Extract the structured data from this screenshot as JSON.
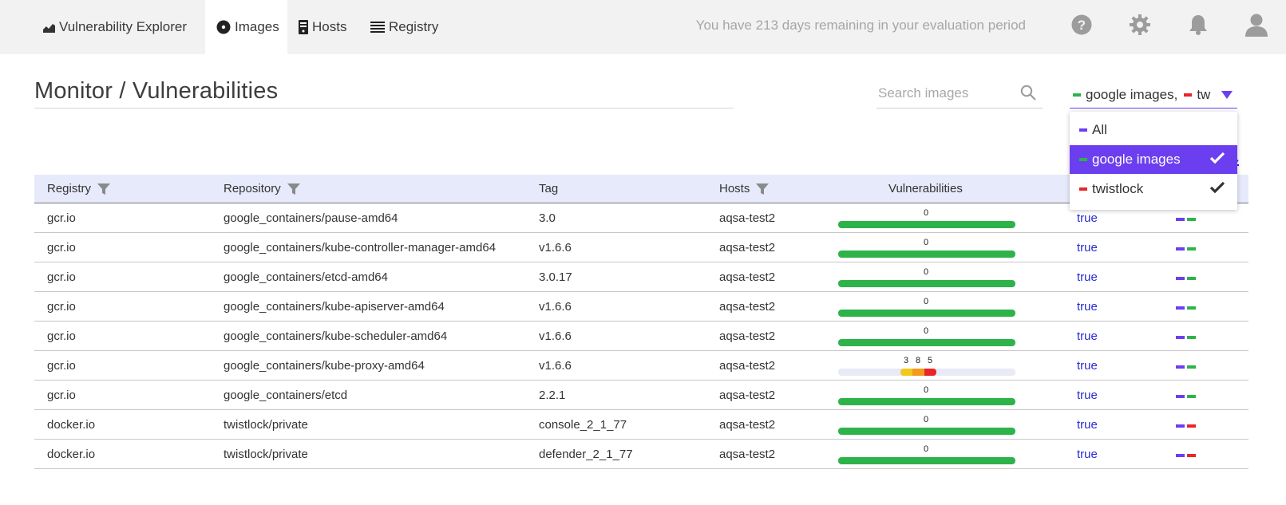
{
  "nav": {
    "tabs": [
      {
        "label": "Vulnerability Explorer",
        "icon": "chart-icon",
        "active": false
      },
      {
        "label": "Images",
        "icon": "image-disc-icon",
        "active": true
      },
      {
        "label": "Hosts",
        "icon": "server-icon",
        "active": false
      },
      {
        "label": "Registry",
        "icon": "list-icon",
        "active": false
      }
    ],
    "evaluation_text": "You have 213 days remaining in your evaluation period",
    "icons": [
      "help-icon",
      "gear-icon",
      "bell-icon",
      "user-icon"
    ]
  },
  "page": {
    "title": "Monitor / Vulnerabilities"
  },
  "search": {
    "placeholder": "Search images",
    "value": ""
  },
  "collections_select": {
    "value_text": "google images,",
    "value_text_2": "tw",
    "options": [
      {
        "label": "All",
        "color": "#6b3ff0",
        "checked": false,
        "highlighted": false
      },
      {
        "label": "google images",
        "color": "#2db34a",
        "checked": true,
        "highlighted": true
      },
      {
        "label": "twistlock",
        "color": "#e8262a",
        "checked": true,
        "highlighted": false
      }
    ]
  },
  "table": {
    "headers": {
      "registry": "Registry",
      "repository": "Repository",
      "tag": "Tag",
      "hosts": "Hosts",
      "vulnerabilities": "Vulnerabilities"
    },
    "rows": [
      {
        "registry": "gcr.io",
        "repository": "google_containers/pause-amd64",
        "tag": "3.0",
        "hosts": "aqsa-test2",
        "vuln_total": "0",
        "compliance": "true",
        "collections": [
          "#6b3ff0",
          "#2db34a"
        ]
      },
      {
        "registry": "gcr.io",
        "repository": "google_containers/kube-controller-manager-amd64",
        "tag": "v1.6.6",
        "hosts": "aqsa-test2",
        "vuln_total": "0",
        "compliance": "true",
        "collections": [
          "#6b3ff0",
          "#2db34a"
        ]
      },
      {
        "registry": "gcr.io",
        "repository": "google_containers/etcd-amd64",
        "tag": "3.0.17",
        "hosts": "aqsa-test2",
        "vuln_total": "0",
        "compliance": "true",
        "collections": [
          "#6b3ff0",
          "#2db34a"
        ]
      },
      {
        "registry": "gcr.io",
        "repository": "google_containers/kube-apiserver-amd64",
        "tag": "v1.6.6",
        "hosts": "aqsa-test2",
        "vuln_total": "0",
        "compliance": "true",
        "collections": [
          "#6b3ff0",
          "#2db34a"
        ]
      },
      {
        "registry": "gcr.io",
        "repository": "google_containers/kube-scheduler-amd64",
        "tag": "v1.6.6",
        "hosts": "aqsa-test2",
        "vuln_total": "0",
        "compliance": "true",
        "collections": [
          "#6b3ff0",
          "#2db34a"
        ]
      },
      {
        "registry": "gcr.io",
        "repository": "google_containers/kube-proxy-amd64",
        "tag": "v1.6.6",
        "hosts": "aqsa-test2",
        "vuln_total": null,
        "vuln_breakdown": [
          {
            "count": "3",
            "color": "#f2c81c"
          },
          {
            "count": "8",
            "color": "#f39a1e"
          },
          {
            "count": "5",
            "color": "#e8262a"
          }
        ],
        "compliance": "true",
        "collections": [
          "#6b3ff0",
          "#2db34a"
        ]
      },
      {
        "registry": "gcr.io",
        "repository": "google_containers/etcd",
        "tag": "2.2.1",
        "hosts": "aqsa-test2",
        "vuln_total": "0",
        "compliance": "true",
        "collections": [
          "#6b3ff0",
          "#2db34a"
        ]
      },
      {
        "registry": "docker.io",
        "repository": "twistlock/private",
        "tag": "console_2_1_77",
        "hosts": "aqsa-test2",
        "vuln_total": "0",
        "compliance": "true",
        "collections": [
          "#6b3ff0",
          "#e8262a"
        ]
      },
      {
        "registry": "docker.io",
        "repository": "twistlock/private",
        "tag": "defender_2_1_77",
        "hosts": "aqsa-test2",
        "vuln_total": "0",
        "compliance": "true",
        "collections": [
          "#6b3ff0",
          "#e8262a"
        ]
      }
    ]
  },
  "colors": {
    "accent": "#6b3ff0",
    "ok_bar": "#2db34a",
    "header_bg": "#e6eafb",
    "link": "#2b2bd6"
  }
}
